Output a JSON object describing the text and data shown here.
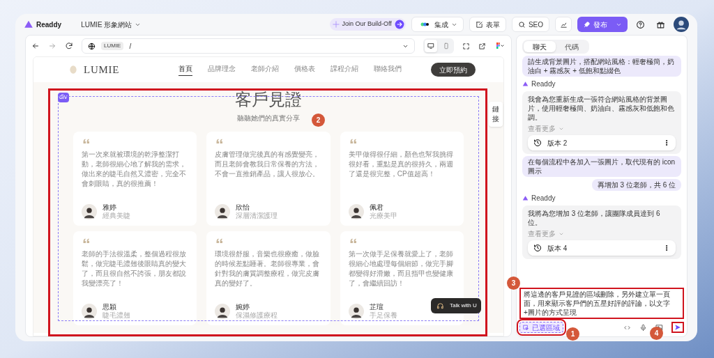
{
  "app": {
    "name": "Readdy",
    "project": "LUMIE 形象網站"
  },
  "toolbar": [
    {
      "kind": "promo",
      "label": "Join Our Build-Off"
    },
    {
      "kind": "menu",
      "label": "集成"
    },
    {
      "kind": "form",
      "label": "表單"
    },
    {
      "kind": "seo",
      "label": "SEO"
    },
    {
      "kind": "chart"
    },
    {
      "kind": "publish",
      "label": "發布"
    },
    {
      "kind": "help"
    },
    {
      "kind": "gift"
    },
    {
      "kind": "avatar"
    }
  ],
  "browser": {
    "site": "LUMIE",
    "path": "/",
    "devices": [
      {
        "kind": "desktop",
        "selected": true
      },
      {
        "kind": "mobile",
        "selected": false
      }
    ]
  },
  "site": {
    "logo": "LUMIE",
    "nav": [
      {
        "label": "首頁",
        "selected": true
      },
      {
        "label": "品牌理念",
        "selected": false
      },
      {
        "label": "老師介紹",
        "selected": false
      },
      {
        "label": "價格表",
        "selected": false
      },
      {
        "label": "課程介紹",
        "selected": false
      },
      {
        "label": "聯絡我們",
        "selected": false
      }
    ],
    "cta": "立即預約",
    "element_tag": "div",
    "side_tab": "鏈接",
    "title": "客戶見證",
    "subtitle": "聽聽她們的真實分享",
    "testimonials": [
      {
        "quote": "第一次來就被環境的乾淨整潔打動，老師很細心地了解我的需求，做出來的睫毛自然又濃密，完全不會刺眼睛，真的很推薦！",
        "name": "雅婷",
        "service": "經典美睫"
      },
      {
        "quote": "皮膚管理做完後真的有感覺變亮，而且老師會教我日常保養的方法，不會一直推銷產品，讓人很放心。",
        "name": "欣怡",
        "service": "深層清潔護理"
      },
      {
        "quote": "美甲做得很仔細，顏色也幫我挑得很好看，重點是真的很持久，兩週了還是很完整，CP值超高！",
        "name": "佩君",
        "service": "光療美甲"
      },
      {
        "quote": "老師的手法很溫柔，整個過程很放鬆，做完睫毛濃翹後眼睛真的變大了，而且很自然不誇張，朋友都說我變漂亮了！",
        "name": "思穎",
        "service": "睫毛濃翹"
      },
      {
        "quote": "環境很舒服，音樂也很療癒，做臉的時候差點睡著。老師很專業，會針對我的膚質調整療程，做完皮膚真的變好了。",
        "name": "婉婷",
        "service": "保濕修護療程"
      },
      {
        "quote": "第一次做手足保養就愛上了，老師很細心地處理每個細節，做完手腳都變得好滑嫩，而且指甲也變健康了，會繼續回訪！",
        "name": "芷瑄",
        "service": "手足保養"
      }
    ],
    "chat_button": "Talk with U"
  },
  "chat": {
    "tabs": [
      {
        "label": "聊天",
        "selected": true
      },
      {
        "label": "代碼",
        "selected": false
      }
    ],
    "messages": [
      {
        "kind": "user",
        "text": "請生成背景圖片，搭配網站風格：輕奢極簡，奶油白 + 霧感灰 + 低飽和點綴色"
      },
      {
        "kind": "assistant",
        "sender": "Readdy",
        "text": "我會為您重新生成一張符合網站風格的背景圖片，使用輕奢極簡、奶油白、霧感灰和低飽和色調。",
        "more": "查看更多",
        "version": "版本 2"
      },
      {
        "kind": "user",
        "text": "在每個流程中各加入一張圖片，取代現有的 icon 圖示"
      },
      {
        "kind": "user",
        "text": "再增加 3 位老師，共 6 位"
      },
      {
        "kind": "assistant",
        "sender": "Readdy",
        "text": "我將為您增加 3 位老師，讓團隊成員達到 6 位。",
        "more": "查看更多",
        "version": "版本 4"
      }
    ],
    "input": "將這邊的客戶見證的區域刪除，另外建立單一頁面，用來顯示客戶們的五星好評的評論，以文字+圖片的方式呈現",
    "chip": "已選區域"
  },
  "annotations": [
    {
      "number": "1"
    },
    {
      "number": "2"
    },
    {
      "number": "3"
    },
    {
      "number": "4"
    }
  ]
}
